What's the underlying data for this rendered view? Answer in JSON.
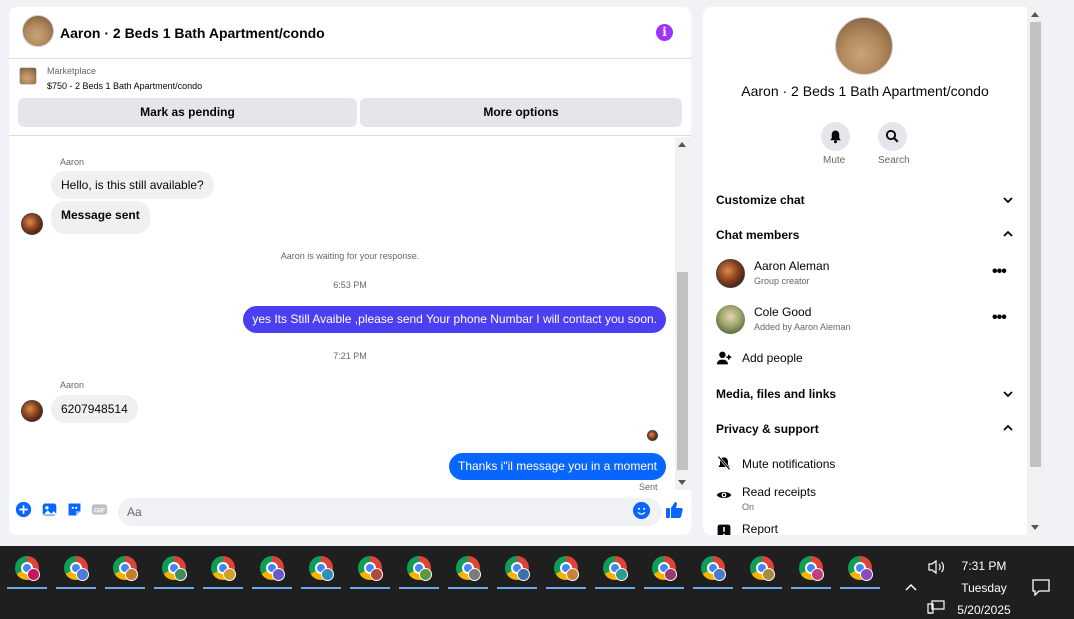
{
  "chat": {
    "title": "Aaron · 2 Beds 1 Bath Apartment/condo",
    "listing": {
      "category": "Marketplace",
      "price_title": "$750 - 2 Beds 1 Bath Apartment/condo",
      "pending_label": "Mark as pending",
      "more_label": "More options"
    },
    "messages": {
      "sender1": "Aaron",
      "msg1": "Hello, is this still available?",
      "msg2": "Message sent",
      "system": "Aaron is waiting for your response.",
      "time1": "6:53 PM",
      "out1": "yes Its Still Avaible ,please send Your phone Numbar I will contact you soon.",
      "time2": "7:21 PM",
      "sender2": "Aaron",
      "msg3": "6207948514",
      "out2": "Thanks i\"il message you in a moment",
      "status": "Sent"
    },
    "composer": {
      "placeholder": "Aa",
      "icons": [
        "plus-icon",
        "photo-icon",
        "sticker-icon",
        "gif-icon",
        "emoji-icon",
        "thumbs-up-icon"
      ]
    },
    "colors": {
      "outgoing_purple": "#4c3ff2",
      "outgoing_blue": "#0866ff",
      "accent": "#a033ff"
    }
  },
  "details": {
    "title": "Aaron · 2 Beds 1 Bath Apartment/condo",
    "mute_label": "Mute",
    "search_label": "Search",
    "customize": "Customize chat",
    "members_header": "Chat members",
    "members": [
      {
        "name": "Aaron Aleman",
        "role": "Group creator"
      },
      {
        "name": "Cole Good",
        "role": "Added by Aaron Aleman"
      }
    ],
    "add_people": "Add people",
    "media": "Media, files and links",
    "privacy": "Privacy & support",
    "mute_notifications": "Mute notifications",
    "read_receipts": "Read receipts",
    "read_receipts_status": "On",
    "report": "Report"
  },
  "taskbar": {
    "apps_count_note": "17 Chrome windows",
    "time": "7:31 PM",
    "day": "Tuesday",
    "date": "5/20/2025"
  }
}
